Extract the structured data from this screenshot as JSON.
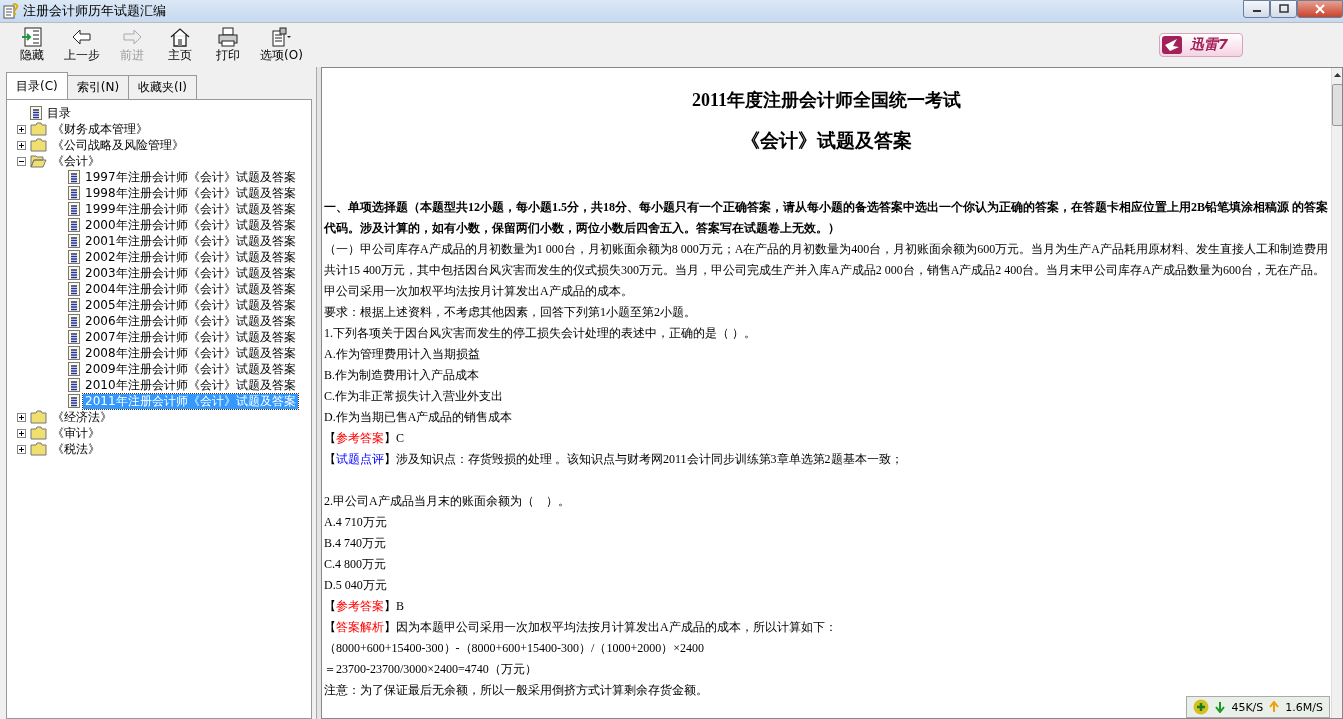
{
  "window": {
    "title": "注册会计师历年试题汇编"
  },
  "toolbar": [
    {
      "label": "隐藏",
      "disabled": false
    },
    {
      "label": "上一步",
      "disabled": false
    },
    {
      "label": "前进",
      "disabled": true
    },
    {
      "label": "主页",
      "disabled": false
    },
    {
      "label": "打印",
      "disabled": false
    },
    {
      "label": "选项(O)",
      "disabled": false
    }
  ],
  "badge": {
    "label": "迅雷7"
  },
  "tabs": [
    {
      "label": "目录(C)",
      "selected": true
    },
    {
      "label": "索引(N)",
      "selected": false
    },
    {
      "label": "收藏夹(I)",
      "selected": false
    }
  ],
  "tree": [
    {
      "label": "目录",
      "kind": "doc",
      "selected": false
    },
    {
      "label": "《财务成本管理》",
      "kind": "folder",
      "expanded": false
    },
    {
      "label": "《公司战略及风险管理》",
      "kind": "folder",
      "expanded": false
    },
    {
      "label": "《会计》",
      "kind": "folder",
      "expanded": true,
      "children": [
        {
          "label": "1997年注册会计师《会计》试题及答案",
          "kind": "doc",
          "selected": false
        },
        {
          "label": "1998年注册会计师《会计》试题及答案",
          "kind": "doc",
          "selected": false
        },
        {
          "label": "1999年注册会计师《会计》试题及答案",
          "kind": "doc",
          "selected": false
        },
        {
          "label": "2000年注册会计师《会计》试题及答案",
          "kind": "doc",
          "selected": false
        },
        {
          "label": "2001年注册会计师《会计》试题及答案",
          "kind": "doc",
          "selected": false
        },
        {
          "label": "2002年注册会计师《会计》试题及答案",
          "kind": "doc",
          "selected": false
        },
        {
          "label": "2003年注册会计师《会计》试题及答案",
          "kind": "doc",
          "selected": false
        },
        {
          "label": "2004年注册会计师《会计》试题及答案",
          "kind": "doc",
          "selected": false
        },
        {
          "label": "2005年注册会计师《会计》试题及答案",
          "kind": "doc",
          "selected": false
        },
        {
          "label": "2006年注册会计师《会计》试题及答案",
          "kind": "doc",
          "selected": false
        },
        {
          "label": "2007年注册会计师《会计》试题及答案",
          "kind": "doc",
          "selected": false
        },
        {
          "label": "2008年注册会计师《会计》试题及答案",
          "kind": "doc",
          "selected": false
        },
        {
          "label": "2009年注册会计师《会计》试题及答案",
          "kind": "doc",
          "selected": false
        },
        {
          "label": "2010年注册会计师《会计》试题及答案",
          "kind": "doc",
          "selected": false
        },
        {
          "label": "2011年注册会计师《会计》试题及答案",
          "kind": "doc",
          "selected": true
        }
      ]
    },
    {
      "label": "《经济法》",
      "kind": "folder",
      "expanded": false
    },
    {
      "label": "《审计》",
      "kind": "folder",
      "expanded": false
    },
    {
      "label": "《税法》",
      "kind": "folder",
      "expanded": false
    }
  ],
  "document": {
    "titles": [
      "2011年度注册会计师全国统一考试",
      "《会计》试题及答案"
    ],
    "lines": [
      {
        "kind": "heading",
        "text": "一、单项选择题（本题型共12小题，每小题1.5分，共18分、每小题只有一个正确答案，请从每小题的备选答案中选出一个你认为正确的答案，在答题卡相应位置上用2B铅笔填涂相稿源 的答案代码。涉及计算的，如有小数，保留两们小数，两位小数后四舍五入。答案写在试题卷上无效。）"
      },
      {
        "kind": "text",
        "text": "（一）甲公司库存A产成品的月初数量为1 000台，月初账面余额为8 000万元；A在产品的月初数量为400台，月初账面余额为600万元。当月为生产A产品耗用原材料、发生直接人工和制造费用共计15 400万元，其中包括因台风灾害而发生的仪式损失300万元。当月，甲公司完成生产并入库A产成品2 000台，销售A产成品2 400台。当月末甲公司库存A产成品数量为600台，无在产品。"
      },
      {
        "kind": "text",
        "text": "甲公司采用一次加权平均法按月计算发出A产成品的成本。"
      },
      {
        "kind": "text",
        "text": "要求：根据上述资料，不考虑其他因素，回答下列第1小题至第2小题。"
      },
      {
        "kind": "text",
        "text": "1.下列各项关于因台风灾害而发生的停工损失会计处理的表述中，正确的是（ ）。"
      },
      {
        "kind": "text",
        "text": "A.作为管理费用计入当期损益"
      },
      {
        "kind": "text",
        "text": "B.作为制造费用计入产品成本"
      },
      {
        "kind": "text",
        "text": "C.作为非正常损失计入营业外支出"
      },
      {
        "kind": "text",
        "text": "D.作为当期已售A产成品的销售成本"
      },
      {
        "kind": "answer",
        "open": "【",
        "label": "参考答案",
        "rest": "】C"
      },
      {
        "kind": "review",
        "open": "【",
        "label": "试题点评",
        "rest": "】涉及知识点：存货毁损的处理 。该知识点与财考网2011会计同步训练第3章单选第2题基本一致；"
      },
      {
        "kind": "gap"
      },
      {
        "kind": "text",
        "text": "2.甲公司A产成品当月末的账面余额为（　）。"
      },
      {
        "kind": "text",
        "text": "A.4 710万元"
      },
      {
        "kind": "text",
        "text": "B.4 740万元"
      },
      {
        "kind": "text",
        "text": "C.4 800万元"
      },
      {
        "kind": "text",
        "text": "D.5 040万元"
      },
      {
        "kind": "answer",
        "open": "【",
        "label": "参考答案",
        "rest": "】B"
      },
      {
        "kind": "answer",
        "open": "【",
        "label": "答案解析",
        "rest": "】因为本题甲公司采用一次加权平均法按月计算发出A产成品的成本，所以计算如下："
      },
      {
        "kind": "text",
        "text": "（8000+600+15400-300）-（8000+600+15400-300）/（1000+2000）×2400"
      },
      {
        "kind": "text",
        "text": "＝23700-23700/3000×2400=4740（万元）"
      },
      {
        "kind": "text",
        "text": "注意：为了保证最后无余额，所以一般采用倒挤方式计算剩余存货金额。"
      }
    ]
  },
  "speed_widget": {
    "download": "45K/S",
    "upload": "1.6M/S"
  }
}
